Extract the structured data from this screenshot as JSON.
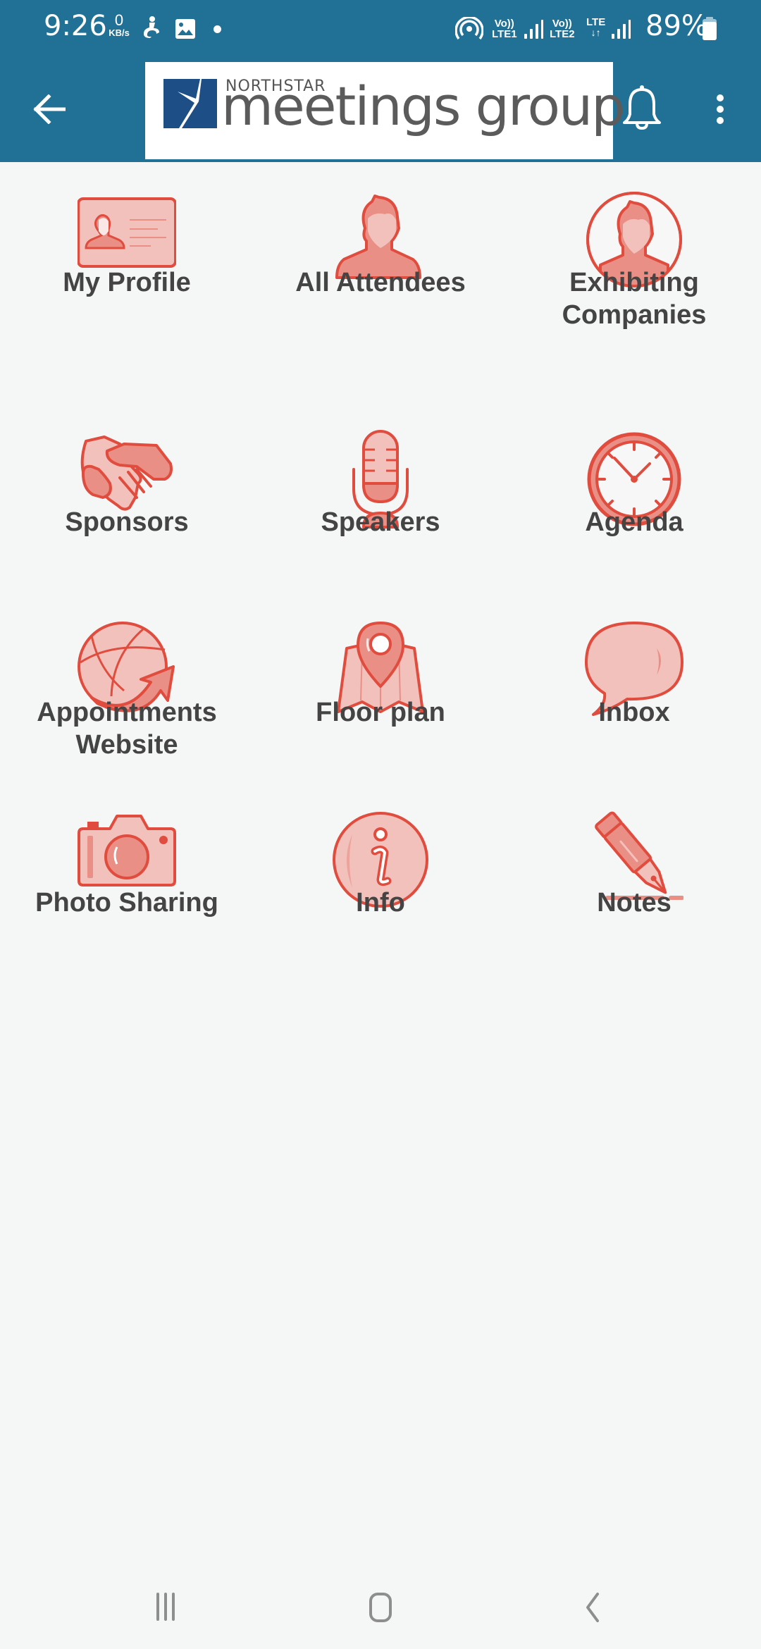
{
  "status_bar": {
    "time": "9:26",
    "net_speed_value": "0",
    "net_speed_unit": "KB/s",
    "left_icons": [
      "accessibility-icon",
      "gallery-icon",
      "notification-dot"
    ],
    "right_icons": [
      "hotspot-icon",
      "signal-sim1-icon",
      "signal-sim2-icon",
      "battery-icon"
    ],
    "sim1_label_top": "Vo))",
    "sim1_label_bottom": "LTE1",
    "sim2_label_top": "Vo))",
    "sim2_label_bottom": "LTE2",
    "data_label": "LTE",
    "battery_percent": "89%"
  },
  "app_bar": {
    "back_icon": "arrow-left-icon",
    "logo_top": "NORTHSTAR",
    "logo_main": "meetings group",
    "notification_icon": "bell-icon",
    "overflow_icon": "more-vertical-icon",
    "background": "#217196"
  },
  "theme": {
    "accent": "#e04c3e",
    "accent_fill": "#f2c1bc",
    "accent_mid": "#ea8f86",
    "label_color": "#444444",
    "page_bg": "#f5f6f6"
  },
  "menu": {
    "items": [
      {
        "label_1": "My Profile",
        "label_2": "",
        "icon": "id-card-icon"
      },
      {
        "label_1": "All Attendees",
        "label_2": "",
        "icon": "person-icon"
      },
      {
        "label_1": "Exhibiting",
        "label_2": "Companies",
        "icon": "person-circle-icon"
      },
      {
        "label_1": "Sponsors",
        "label_2": "",
        "icon": "handshake-icon"
      },
      {
        "label_1": "Speakers",
        "label_2": "",
        "icon": "microphone-icon"
      },
      {
        "label_1": "Agenda",
        "label_2": "",
        "icon": "clock-icon"
      },
      {
        "label_1": "Appointments",
        "label_2": "Website",
        "icon": "globe-arrow-icon"
      },
      {
        "label_1": "Floor plan",
        "label_2": "",
        "icon": "map-pin-icon"
      },
      {
        "label_1": "Inbox",
        "label_2": "",
        "icon": "speech-bubble-icon"
      },
      {
        "label_1": "Photo Sharing",
        "label_2": "",
        "icon": "camera-icon"
      },
      {
        "label_1": "Info",
        "label_2": "",
        "icon": "info-icon"
      },
      {
        "label_1": "Notes",
        "label_2": "",
        "icon": "fountain-pen-icon"
      }
    ]
  },
  "nav_bar": {
    "recents_icon": "recents-icon",
    "home_icon": "home-icon",
    "back_icon": "back-chevron-icon"
  }
}
